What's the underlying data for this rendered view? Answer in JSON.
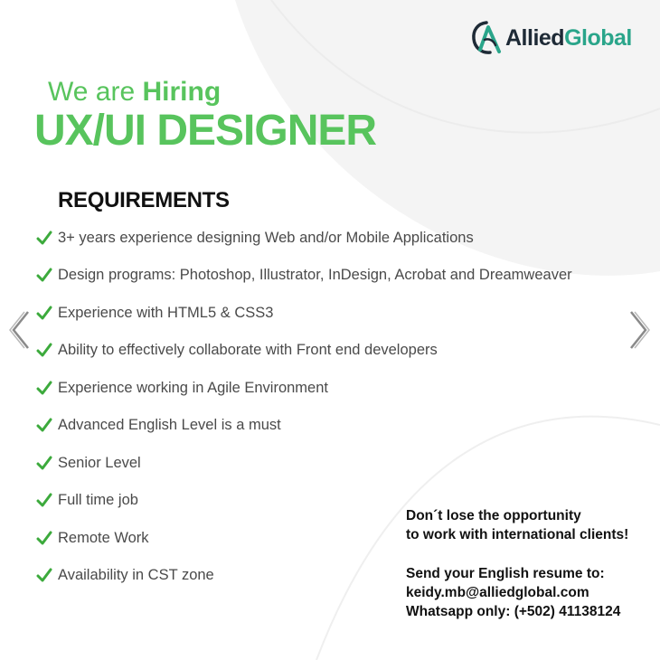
{
  "logo": {
    "allied": "Allied",
    "global": "Global",
    "mark": "allied-global-logo-mark"
  },
  "headline": {
    "intro": "We are ",
    "intro_bold": "Hiring",
    "role": "UX/UI DESIGNER"
  },
  "requirements": {
    "title": "REQUIREMENTS",
    "items": [
      "3+ years experience designing Web and/or Mobile Applications",
      "Design programs: Photoshop, Illustrator, InDesign, Acrobat and Dreamweaver",
      "Experience with HTML5 & CSS3",
      "Ability to effectively collaborate with Front end developers",
      "Experience working in Agile Environment",
      "Advanced English Level is a must",
      "Senior Level",
      "Full time job",
      "Remote Work",
      "Availability in CST zone"
    ]
  },
  "cta": {
    "line1": "Don´t lose the opportunity",
    "line2": "to work with international clients!",
    "send": "Send your English resume to:",
    "email": "keidy.mb@alliedglobal.com",
    "whatsapp": "Whatsapp only: (+502) 41138124"
  },
  "navigation": {
    "prev_icon": "chevron-left-icon",
    "next_icon": "chevron-right-icon"
  },
  "colors": {
    "brand_green": "#58c45d",
    "check_green": "#3caa3c",
    "logo_dark": "#1e2a36",
    "logo_teal": "#2aa58a"
  }
}
